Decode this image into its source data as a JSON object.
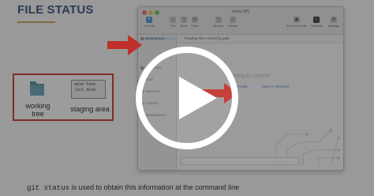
{
  "slide": {
    "title": "FILE STATUS",
    "working_tree_label": "working\ntree",
    "staging_area_label": "staging area",
    "staging_hashes": [
      "a934 f4eA",
      "73c5 dc1B"
    ],
    "bottom_code": "git status",
    "bottom_text": " is used to obtain this information at the command line"
  },
  "window": {
    "title": "repos (35)",
    "toolbar": {
      "commit": "Commit",
      "pull": "Pull",
      "push": "Push",
      "fetch": "Fetch",
      "branch": "Branch",
      "merge": "Merge",
      "show_in_finder": "Show in Finder",
      "terminal": "Terminal",
      "settings": "Settings"
    },
    "sidebar": {
      "items": [
        "WORKSPACE",
        "BRANCHES",
        "TAGS",
        "REMOTES",
        "STASHES",
        "SUBMODULES"
      ]
    },
    "branch_bar_text": "Pending files, sorted by path",
    "main": {
      "nothing_text": "Nothing to commit",
      "link_finder": "Show in Finder",
      "link_terminal": "Open in Terminal"
    }
  },
  "overlay": {
    "colors": {
      "arrow": "#c0302a",
      "play": "#ffffff"
    }
  }
}
